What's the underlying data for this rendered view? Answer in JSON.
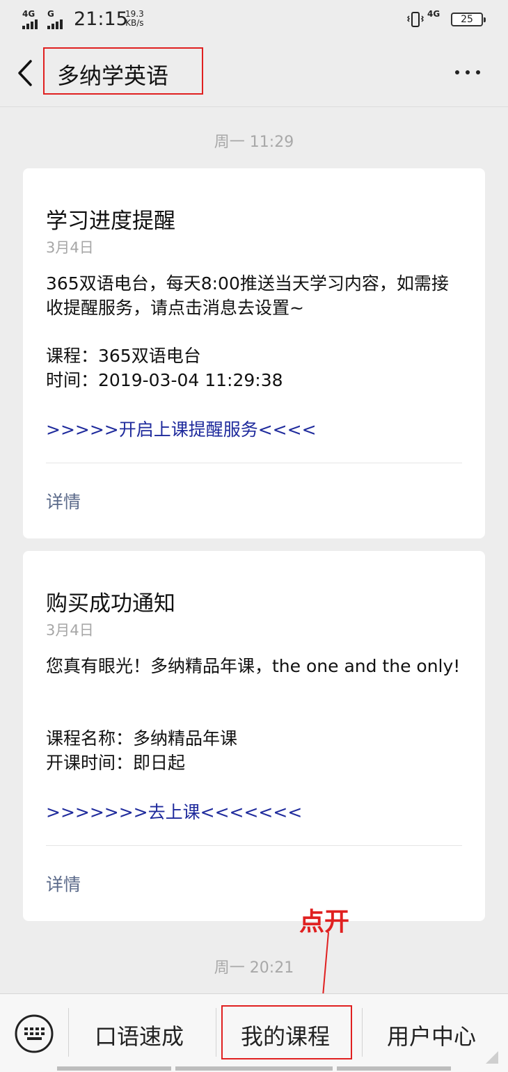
{
  "status_bar": {
    "signal1_label": "4G",
    "signal2_label": "G",
    "time": "21:15",
    "speed_value": "19.3",
    "speed_unit": "KB/s",
    "network_label": "4G",
    "battery_level": "25"
  },
  "nav": {
    "title": "多纳学英语",
    "back_icon": "chevron-left-icon",
    "more_icon": "more-dots-icon"
  },
  "chat": {
    "timestamp_1": "周一 11:29",
    "card1": {
      "title": "学习进度提醒",
      "date": "3月4日",
      "body": "365双语电台，每天8:00推送当天学习内容，如需接收提醒服务，请点击消息去设置~",
      "course_line": "课程：365双语电台",
      "time_line": "时间：2019-03-04 11:29:38",
      "link": ">>>>>开启上课提醒服务<<<<",
      "details": "详情"
    },
    "card2": {
      "title": "购买成功通知",
      "date": "3月4日",
      "body": "您真有眼光！多纳精品年课，the one and the only!",
      "course_line": "课程名称：多纳精品年课",
      "start_line": "开课时间：即日起",
      "link": ">>>>>>>去上课<<<<<<<",
      "details": "详情"
    },
    "timestamp_2": "周一 20:21"
  },
  "annotation": {
    "text": "点开",
    "color": "#e02020"
  },
  "bottom_menu": {
    "keyboard_icon": "keyboard-icon",
    "items": [
      "口语速成",
      "我的课程",
      "用户中心"
    ]
  },
  "colors": {
    "background": "#ededed",
    "link": "#1e2a9c",
    "details": "#5b6a8a",
    "highlight": "#e02020"
  }
}
